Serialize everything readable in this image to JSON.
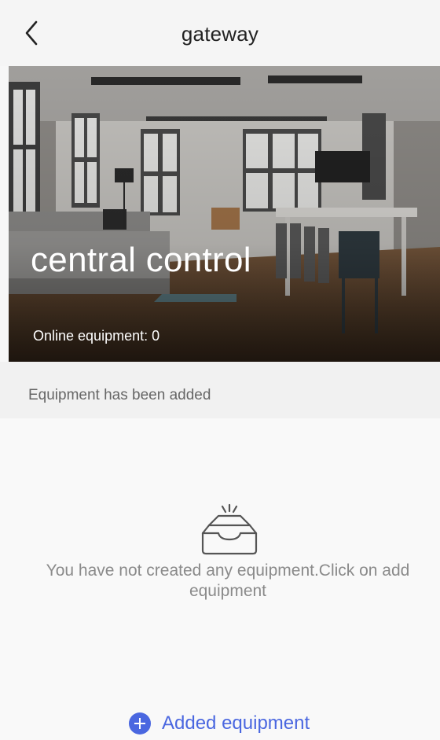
{
  "header": {
    "title": "gateway",
    "back_icon": "chevron-left-icon"
  },
  "hero": {
    "title": "central control",
    "online_label": "Online equipment: 0"
  },
  "section": {
    "label": "Equipment has been added"
  },
  "empty_state": {
    "icon": "empty-inbox-icon",
    "message": "You have not created any equipment.Click on add equipment"
  },
  "add_button": {
    "label": "Added equipment",
    "icon": "plus-circle-icon",
    "color": "#4a67e0"
  }
}
